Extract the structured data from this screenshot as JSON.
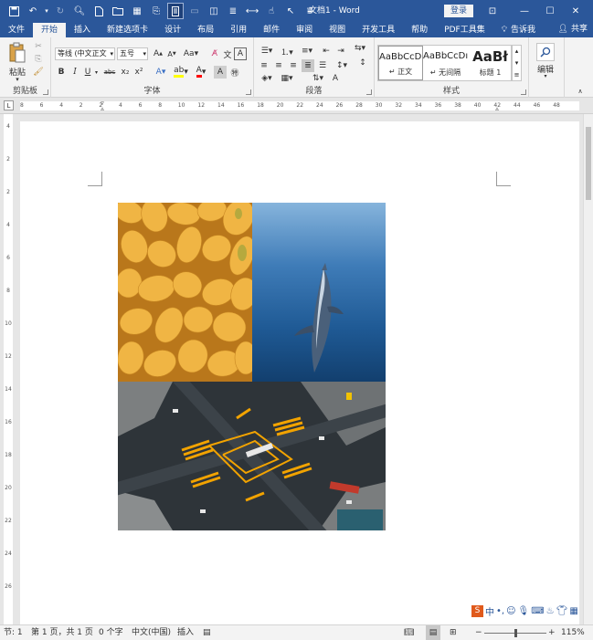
{
  "titlebar": {
    "doc_title": "文档1 - Word",
    "login_label": "登录",
    "controls": [
      "ribbon-display-icon",
      "minimize-icon",
      "maximize-icon",
      "close-icon"
    ]
  },
  "tabs": [
    {
      "label": "文件",
      "active": false
    },
    {
      "label": "开始",
      "active": true
    },
    {
      "label": "插入",
      "active": false
    },
    {
      "label": "新建选项卡",
      "active": false
    },
    {
      "label": "设计",
      "active": false
    },
    {
      "label": "布局",
      "active": false
    },
    {
      "label": "引用",
      "active": false
    },
    {
      "label": "邮件",
      "active": false
    },
    {
      "label": "审阅",
      "active": false
    },
    {
      "label": "视图",
      "active": false
    },
    {
      "label": "开发工具",
      "active": false
    },
    {
      "label": "帮助",
      "active": false
    },
    {
      "label": "PDF工具集",
      "active": false
    }
  ],
  "tell_me": "告诉我",
  "share": "共享",
  "ribbon": {
    "clipboard": {
      "label": "剪贴板",
      "paste": "粘贴"
    },
    "font": {
      "label": "字体",
      "font_name": "等线 (中文正文",
      "font_size": "五号",
      "bold": "B",
      "italic": "I",
      "underline": "U",
      "strike": "abc",
      "sub": "x₂",
      "sup": "x²"
    },
    "paragraph": {
      "label": "段落"
    },
    "styles": {
      "label": "样式",
      "items": [
        {
          "sample": "AaBbCcDı",
          "name": "↵ 正文"
        },
        {
          "sample": "AaBbCcDı",
          "name": "↵ 无间隔"
        },
        {
          "sample": "AaBł",
          "name": "标题 1"
        }
      ]
    },
    "editing": {
      "label": "编辑"
    }
  },
  "ruler_labels": [
    "8",
    "6",
    "4",
    "2",
    "2",
    "4",
    "6",
    "8",
    "10",
    "12",
    "14",
    "16",
    "18",
    "20",
    "22",
    "24",
    "26",
    "28",
    "30",
    "32",
    "34",
    "36",
    "38",
    "40",
    "42",
    "44",
    "46",
    "48"
  ],
  "vruler_labels": [
    "4",
    "2",
    "2",
    "4",
    "6",
    "8",
    "10",
    "12",
    "14",
    "16",
    "18",
    "20",
    "22",
    "24",
    "26"
  ],
  "statusbar": {
    "section": "节: 1",
    "page": "第 1 页，共 1 页",
    "words": "0 个字",
    "language": "中文(中国)",
    "insert_mode": "插入",
    "zoom": "115%"
  },
  "colors": {
    "accent": "#2b579a",
    "highlight": "#ffff00",
    "font_color": "#ff0000"
  }
}
